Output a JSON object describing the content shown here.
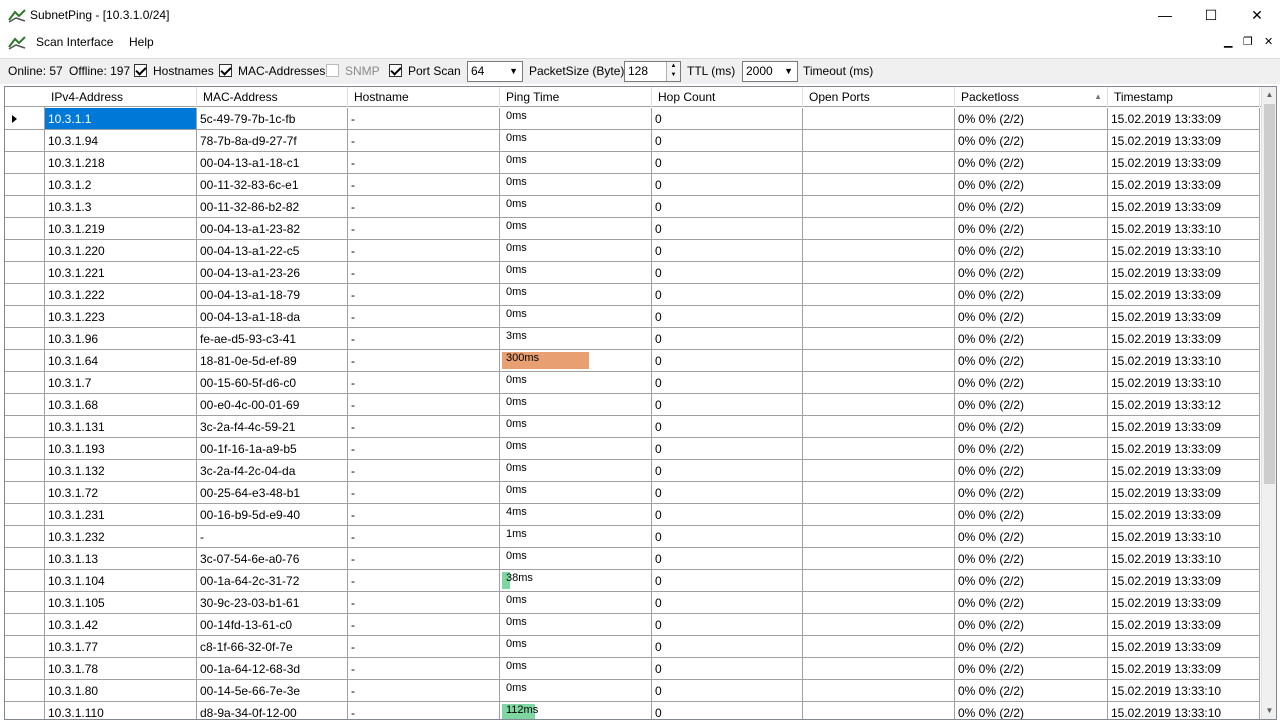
{
  "window": {
    "title": "SubnetPing - [10.3.1.0/24]",
    "minimize_glyph": "—",
    "maximize_glyph": "☐",
    "close_glyph": "✕"
  },
  "menu": {
    "items": [
      "Scan Interface",
      "Help"
    ],
    "mdi_minimize": "▁",
    "mdi_restore": "❐",
    "mdi_close": "✕"
  },
  "toolbar": {
    "online": "Online: 57",
    "offline": "Offline: 197",
    "hostnames_label": "Hostnames",
    "hostnames_checked": true,
    "mac_label": "MAC-Addresses",
    "mac_checked": true,
    "snmp_label": "SNMP",
    "snmp_checked": false,
    "portscan_label": "Port Scan",
    "portscan_checked": true,
    "packetsize_value": "64",
    "packetsize_label": "PacketSize (Byte)",
    "ttl_value": "128",
    "ttl_label": "TTL (ms)",
    "timeout_value": "2000",
    "timeout_label": "Timeout (ms)"
  },
  "grid": {
    "columns": [
      "IPv4-Address",
      "MAC-Address",
      "Hostname",
      "Ping Time",
      "Hop Count",
      "Open Ports",
      "Packetloss",
      "Timestamp"
    ],
    "sorted_column": "Packetloss",
    "colors": {
      "ping_high": "#e8a073",
      "ping_med": "#7ed6a3",
      "selection": "#0078d7"
    },
    "rows": [
      {
        "ip": "10.3.1.1",
        "mac": "5c-49-79-7b-1c-fb",
        "host": "-",
        "ping": "0ms",
        "ping_level": 0,
        "hops": "0",
        "ports": "",
        "loss": "0% 0% (2/2)",
        "ts": "15.02.2019 13:33:09"
      },
      {
        "ip": "10.3.1.94",
        "mac": "78-7b-8a-d9-27-7f",
        "host": "-",
        "ping": "0ms",
        "ping_level": 0,
        "hops": "0",
        "ports": "",
        "loss": "0% 0% (2/2)",
        "ts": "15.02.2019 13:33:09"
      },
      {
        "ip": "10.3.1.218",
        "mac": "00-04-13-a1-18-c1",
        "host": "-",
        "ping": "0ms",
        "ping_level": 0,
        "hops": "0",
        "ports": "",
        "loss": "0% 0% (2/2)",
        "ts": "15.02.2019 13:33:09"
      },
      {
        "ip": "10.3.1.2",
        "mac": "00-11-32-83-6c-e1",
        "host": "-",
        "ping": "0ms",
        "ping_level": 0,
        "hops": "0",
        "ports": "",
        "loss": "0% 0% (2/2)",
        "ts": "15.02.2019 13:33:09"
      },
      {
        "ip": "10.3.1.3",
        "mac": "00-11-32-86-b2-82",
        "host": "-",
        "ping": "0ms",
        "ping_level": 0,
        "hops": "0",
        "ports": "",
        "loss": "0% 0% (2/2)",
        "ts": "15.02.2019 13:33:09"
      },
      {
        "ip": "10.3.1.219",
        "mac": "00-04-13-a1-23-82",
        "host": "-",
        "ping": "0ms",
        "ping_level": 0,
        "hops": "0",
        "ports": "",
        "loss": "0% 0% (2/2)",
        "ts": "15.02.2019 13:33:10"
      },
      {
        "ip": "10.3.1.220",
        "mac": "00-04-13-a1-22-c5",
        "host": "-",
        "ping": "0ms",
        "ping_level": 0,
        "hops": "0",
        "ports": "",
        "loss": "0% 0% (2/2)",
        "ts": "15.02.2019 13:33:10"
      },
      {
        "ip": "10.3.1.221",
        "mac": "00-04-13-a1-23-26",
        "host": "-",
        "ping": "0ms",
        "ping_level": 0,
        "hops": "0",
        "ports": "",
        "loss": "0% 0% (2/2)",
        "ts": "15.02.2019 13:33:09"
      },
      {
        "ip": "10.3.1.222",
        "mac": "00-04-13-a1-18-79",
        "host": "-",
        "ping": "0ms",
        "ping_level": 0,
        "hops": "0",
        "ports": "",
        "loss": "0% 0% (2/2)",
        "ts": "15.02.2019 13:33:09"
      },
      {
        "ip": "10.3.1.223",
        "mac": "00-04-13-a1-18-da",
        "host": "-",
        "ping": "0ms",
        "ping_level": 0,
        "hops": "0",
        "ports": "",
        "loss": "0% 0% (2/2)",
        "ts": "15.02.2019 13:33:09"
      },
      {
        "ip": "10.3.1.96",
        "mac": "fe-ae-d5-93-c3-41",
        "host": "-",
        "ping": "3ms",
        "ping_level": 0,
        "hops": "0",
        "ports": "",
        "loss": "0% 0% (2/2)",
        "ts": "15.02.2019 13:33:09"
      },
      {
        "ip": "10.3.1.64",
        "mac": "18-81-0e-5d-ef-89",
        "host": "-",
        "ping": "300ms",
        "ping_level": 0.58,
        "ping_color": "high",
        "hops": "0",
        "ports": "",
        "loss": "0% 0% (2/2)",
        "ts": "15.02.2019 13:33:10"
      },
      {
        "ip": "10.3.1.7",
        "mac": "00-15-60-5f-d6-c0",
        "host": "-",
        "ping": "0ms",
        "ping_level": 0,
        "hops": "0",
        "ports": "",
        "loss": "0% 0% (2/2)",
        "ts": "15.02.2019 13:33:10"
      },
      {
        "ip": "10.3.1.68",
        "mac": "00-e0-4c-00-01-69",
        "host": "-",
        "ping": "0ms",
        "ping_level": 0,
        "hops": "0",
        "ports": "",
        "loss": "0% 0% (2/2)",
        "ts": "15.02.2019 13:33:12"
      },
      {
        "ip": "10.3.1.131",
        "mac": "3c-2a-f4-4c-59-21",
        "host": "-",
        "ping": "0ms",
        "ping_level": 0,
        "hops": "0",
        "ports": "",
        "loss": "0% 0% (2/2)",
        "ts": "15.02.2019 13:33:09"
      },
      {
        "ip": "10.3.1.193",
        "mac": "00-1f-16-1a-a9-b5",
        "host": "-",
        "ping": "0ms",
        "ping_level": 0,
        "hops": "0",
        "ports": "",
        "loss": "0% 0% (2/2)",
        "ts": "15.02.2019 13:33:09"
      },
      {
        "ip": "10.3.1.132",
        "mac": "3c-2a-f4-2c-04-da",
        "host": "-",
        "ping": "0ms",
        "ping_level": 0,
        "hops": "0",
        "ports": "",
        "loss": "0% 0% (2/2)",
        "ts": "15.02.2019 13:33:09"
      },
      {
        "ip": "10.3.1.72",
        "mac": "00-25-64-e3-48-b1",
        "host": "-",
        "ping": "0ms",
        "ping_level": 0,
        "hops": "0",
        "ports": "",
        "loss": "0% 0% (2/2)",
        "ts": "15.02.2019 13:33:09"
      },
      {
        "ip": "10.3.1.231",
        "mac": "00-16-b9-5d-e9-40",
        "host": "-",
        "ping": "4ms",
        "ping_level": 0,
        "hops": "0",
        "ports": "",
        "loss": "0% 0% (2/2)",
        "ts": "15.02.2019 13:33:09"
      },
      {
        "ip": "10.3.1.232",
        "mac": "-",
        "host": "-",
        "ping": "1ms",
        "ping_level": 0,
        "hops": "0",
        "ports": "",
        "loss": "0% 0% (2/2)",
        "ts": "15.02.2019 13:33:10"
      },
      {
        "ip": "10.3.1.13",
        "mac": "3c-07-54-6e-a0-76",
        "host": "-",
        "ping": "0ms",
        "ping_level": 0,
        "hops": "0",
        "ports": "",
        "loss": "0% 0% (2/2)",
        "ts": "15.02.2019 13:33:10"
      },
      {
        "ip": "10.3.1.104",
        "mac": "00-1a-64-2c-31-72",
        "host": "-",
        "ping": "38ms",
        "ping_level": 0.05,
        "ping_color": "med",
        "hops": "0",
        "ports": "",
        "loss": "0% 0% (2/2)",
        "ts": "15.02.2019 13:33:09"
      },
      {
        "ip": "10.3.1.105",
        "mac": "30-9c-23-03-b1-61",
        "host": "-",
        "ping": "0ms",
        "ping_level": 0,
        "hops": "0",
        "ports": "",
        "loss": "0% 0% (2/2)",
        "ts": "15.02.2019 13:33:09"
      },
      {
        "ip": "10.3.1.42",
        "mac": "00-14fd-13-61-c0",
        "host": "-",
        "ping": "0ms",
        "ping_level": 0,
        "hops": "0",
        "ports": "",
        "loss": "0% 0% (2/2)",
        "ts": "15.02.2019 13:33:09"
      },
      {
        "ip": "10.3.1.77",
        "mac": "c8-1f-66-32-0f-7e",
        "host": "-",
        "ping": "0ms",
        "ping_level": 0,
        "hops": "0",
        "ports": "",
        "loss": "0% 0% (2/2)",
        "ts": "15.02.2019 13:33:09"
      },
      {
        "ip": "10.3.1.78",
        "mac": "00-1a-64-12-68-3d",
        "host": "-",
        "ping": "0ms",
        "ping_level": 0,
        "hops": "0",
        "ports": "",
        "loss": "0% 0% (2/2)",
        "ts": "15.02.2019 13:33:09"
      },
      {
        "ip": "10.3.1.80",
        "mac": "00-14-5e-66-7e-3e",
        "host": "-",
        "ping": "0ms",
        "ping_level": 0,
        "hops": "0",
        "ports": "",
        "loss": "0% 0% (2/2)",
        "ts": "15.02.2019 13:33:10"
      },
      {
        "ip": "10.3.1.110",
        "mac": "d8-9a-34-0f-12-00",
        "host": "-",
        "ping": "112ms",
        "ping_level": 0.22,
        "ping_color": "med",
        "hops": "0",
        "ports": "",
        "loss": "0% 0% (2/2)",
        "ts": "15.02.2019 13:33:10"
      }
    ]
  }
}
